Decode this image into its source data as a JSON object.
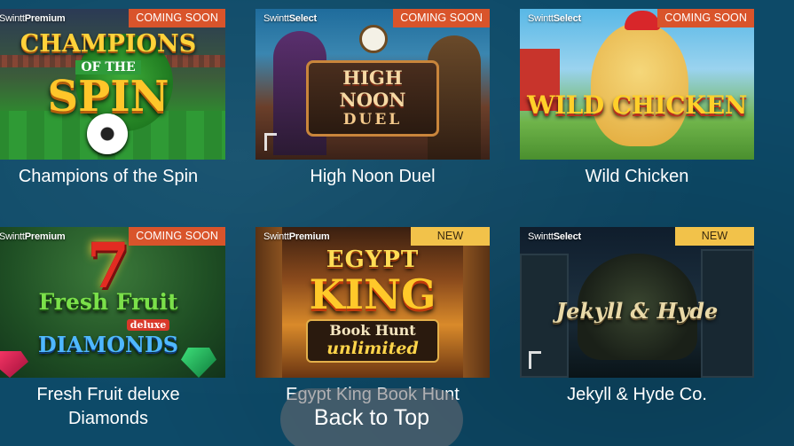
{
  "games": [
    {
      "title": "Champions of the Spin",
      "provider_brand": "Swintt",
      "provider_tier": "Premium",
      "badge": "COMING SOON",
      "art_lines": [
        "CHAMPIONS",
        "OF THE",
        "SPIN"
      ]
    },
    {
      "title": "High Noon Duel",
      "provider_brand": "Swintt",
      "provider_tier": "Select",
      "badge": "COMING SOON",
      "art_lines": [
        "HIGH NOON",
        "DUEL"
      ]
    },
    {
      "title": "Wild Chicken",
      "provider_brand": "Swintt",
      "provider_tier": "Select",
      "badge": "COMING SOON",
      "art_lines": [
        "WILD CHICKEN"
      ]
    },
    {
      "title_line1": "Fresh Fruit deluxe",
      "title_line2": "Diamonds",
      "provider_brand": "Swintt",
      "provider_tier": "Premium",
      "badge": "COMING SOON",
      "art_lines": [
        "7",
        "Fresh Fruit",
        "deluxe",
        "DIAMONDS"
      ]
    },
    {
      "title_line1": "Egypt King Book Hunt",
      "provider_brand": "Swintt",
      "provider_tier": "Premium",
      "badge": "NEW",
      "art_lines": [
        "EGYPT",
        "KING",
        "Book Hunt",
        "unlimited"
      ]
    },
    {
      "title": "Jekyll & Hyde Co.",
      "provider_brand": "Swintt",
      "provider_tier": "Select",
      "badge": "NEW",
      "art_lines": [
        "Jekyll & Hyde"
      ]
    }
  ],
  "back_to_top": "Back to Top",
  "colors": {
    "page_bg": "#0d4a68",
    "badge_coming_soon": "#d9542b",
    "badge_new": "#f2c24a",
    "back_to_top_bg": "rgba(110,110,115,0.55)"
  }
}
